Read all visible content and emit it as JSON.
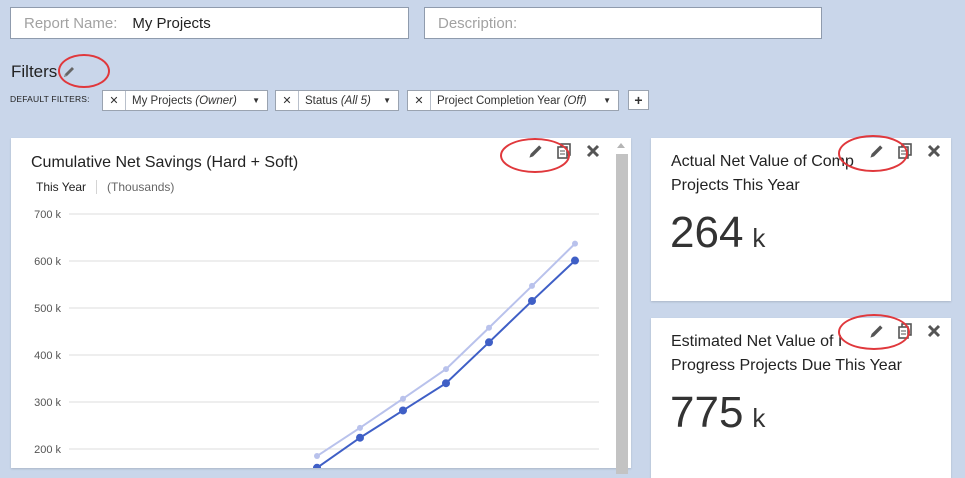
{
  "report_name": {
    "label": "Report Name:",
    "value": "My Projects"
  },
  "description": {
    "placeholder": "Description:"
  },
  "filters": {
    "title": "Filters",
    "default_label": "DEFAULT FILTERS:",
    "chips": [
      {
        "name": "My Projects",
        "qualifier": "(Owner)"
      },
      {
        "name": "Status",
        "qualifier": "(All 5)"
      },
      {
        "name": "Project Completion Year",
        "qualifier": "(Off)"
      }
    ],
    "add_label": "+"
  },
  "chart_panel": {
    "title": "Cumulative Net Savings (Hard + Soft)",
    "tab_active": "This Year",
    "tab_units": "(Thousands)"
  },
  "kpi1": {
    "title_line1": "Actual Net Value of Comp",
    "title_line2": "Projects This Year",
    "value": "264",
    "unit": "k"
  },
  "kpi2": {
    "title_line1": "Estimated Net Value of I",
    "title_line2": "Progress Projects Due This Year",
    "value": "775",
    "unit": "k"
  },
  "colors": {
    "accent_line": "#3f5fc6",
    "light_line": "#b9c2ec",
    "annotation": "#e0383c",
    "background": "#c9d6ea"
  },
  "icons": [
    "pencil-icon",
    "copy-icon",
    "close-icon",
    "caret-down-icon",
    "plus-icon"
  ],
  "chart_data": {
    "type": "line",
    "title": "Cumulative Net Savings (Hard + Soft)",
    "yticks": [
      "700 k",
      "600 k",
      "500 k",
      "400 k",
      "300 k",
      "200 k"
    ],
    "ylim": [
      200,
      700
    ],
    "grid": true,
    "x": [
      6,
      7,
      8,
      9,
      10,
      11,
      12
    ],
    "series": [
      {
        "values": [
          185,
          245,
          307,
          370,
          458,
          547,
          637
        ],
        "color": "#b9c2ec"
      },
      {
        "values": [
          160,
          224,
          282,
          340,
          427,
          515,
          601
        ],
        "color": "#3f5fc6"
      }
    ]
  }
}
